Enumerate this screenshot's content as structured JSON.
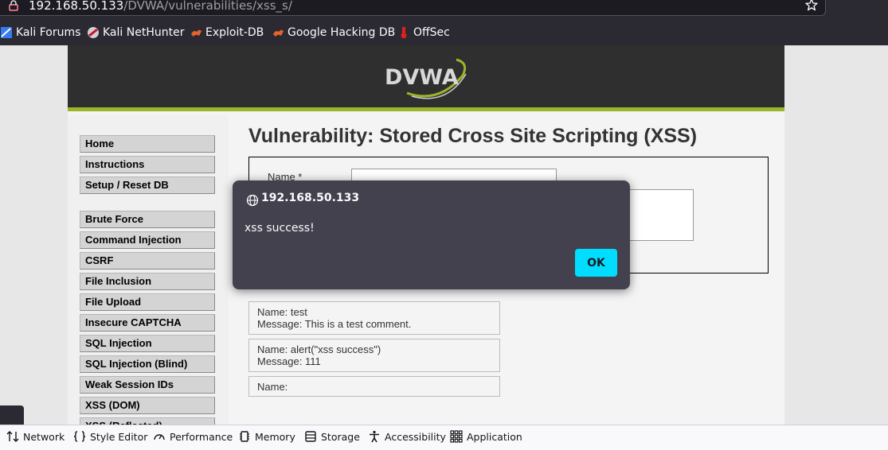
{
  "browser": {
    "url_host": "192.168.50.133",
    "url_path": "/DVWA/vulnerabilities/xss_s/",
    "bookmarks": [
      {
        "label": "Kali Forums",
        "icon": "kali-forums-icon"
      },
      {
        "label": "Kali NetHunter",
        "icon": "kali-nethunter-icon"
      },
      {
        "label": "Exploit-DB",
        "icon": "exploit-db-icon"
      },
      {
        "label": "Google Hacking DB",
        "icon": "ghdb-icon"
      },
      {
        "label": "OffSec",
        "icon": "offsec-icon"
      }
    ]
  },
  "dvwa": {
    "logo_text": "DVWA",
    "menu_group1": [
      "Home",
      "Instructions",
      "Setup / Reset DB"
    ],
    "menu_group2": [
      "Brute Force",
      "Command Injection",
      "CSRF",
      "File Inclusion",
      "File Upload",
      "Insecure CAPTCHA",
      "SQL Injection",
      "SQL Injection (Blind)",
      "Weak Session IDs",
      "XSS (DOM)",
      "XSS (Reflected)"
    ],
    "title": "Vulnerability: Stored Cross Site Scripting (XSS)",
    "form": {
      "name_label": "Name *"
    },
    "entries": [
      {
        "name": "Name: test",
        "message": "Message: This is a test comment."
      },
      {
        "name": "Name: alert(\"xss success\")",
        "message": "Message: 111"
      },
      {
        "name": "Name:",
        "message": ""
      }
    ]
  },
  "dialog": {
    "origin": "192.168.50.133",
    "message": "xss success!",
    "ok_label": "OK"
  },
  "devtools": {
    "tabs": [
      {
        "label": "Network",
        "icon": "network-icon"
      },
      {
        "label": "Style Editor",
        "icon": "style-editor-icon"
      },
      {
        "label": "Performance",
        "icon": "performance-icon"
      },
      {
        "label": "Memory",
        "icon": "memory-icon"
      },
      {
        "label": "Storage",
        "icon": "storage-icon"
      },
      {
        "label": "Accessibility",
        "icon": "accessibility-icon"
      },
      {
        "label": "Application",
        "icon": "application-icon"
      }
    ]
  },
  "colors": {
    "dialog_bg": "#42414d",
    "ok_button": "#00ddff",
    "dvwa_green": "#9ab529"
  }
}
